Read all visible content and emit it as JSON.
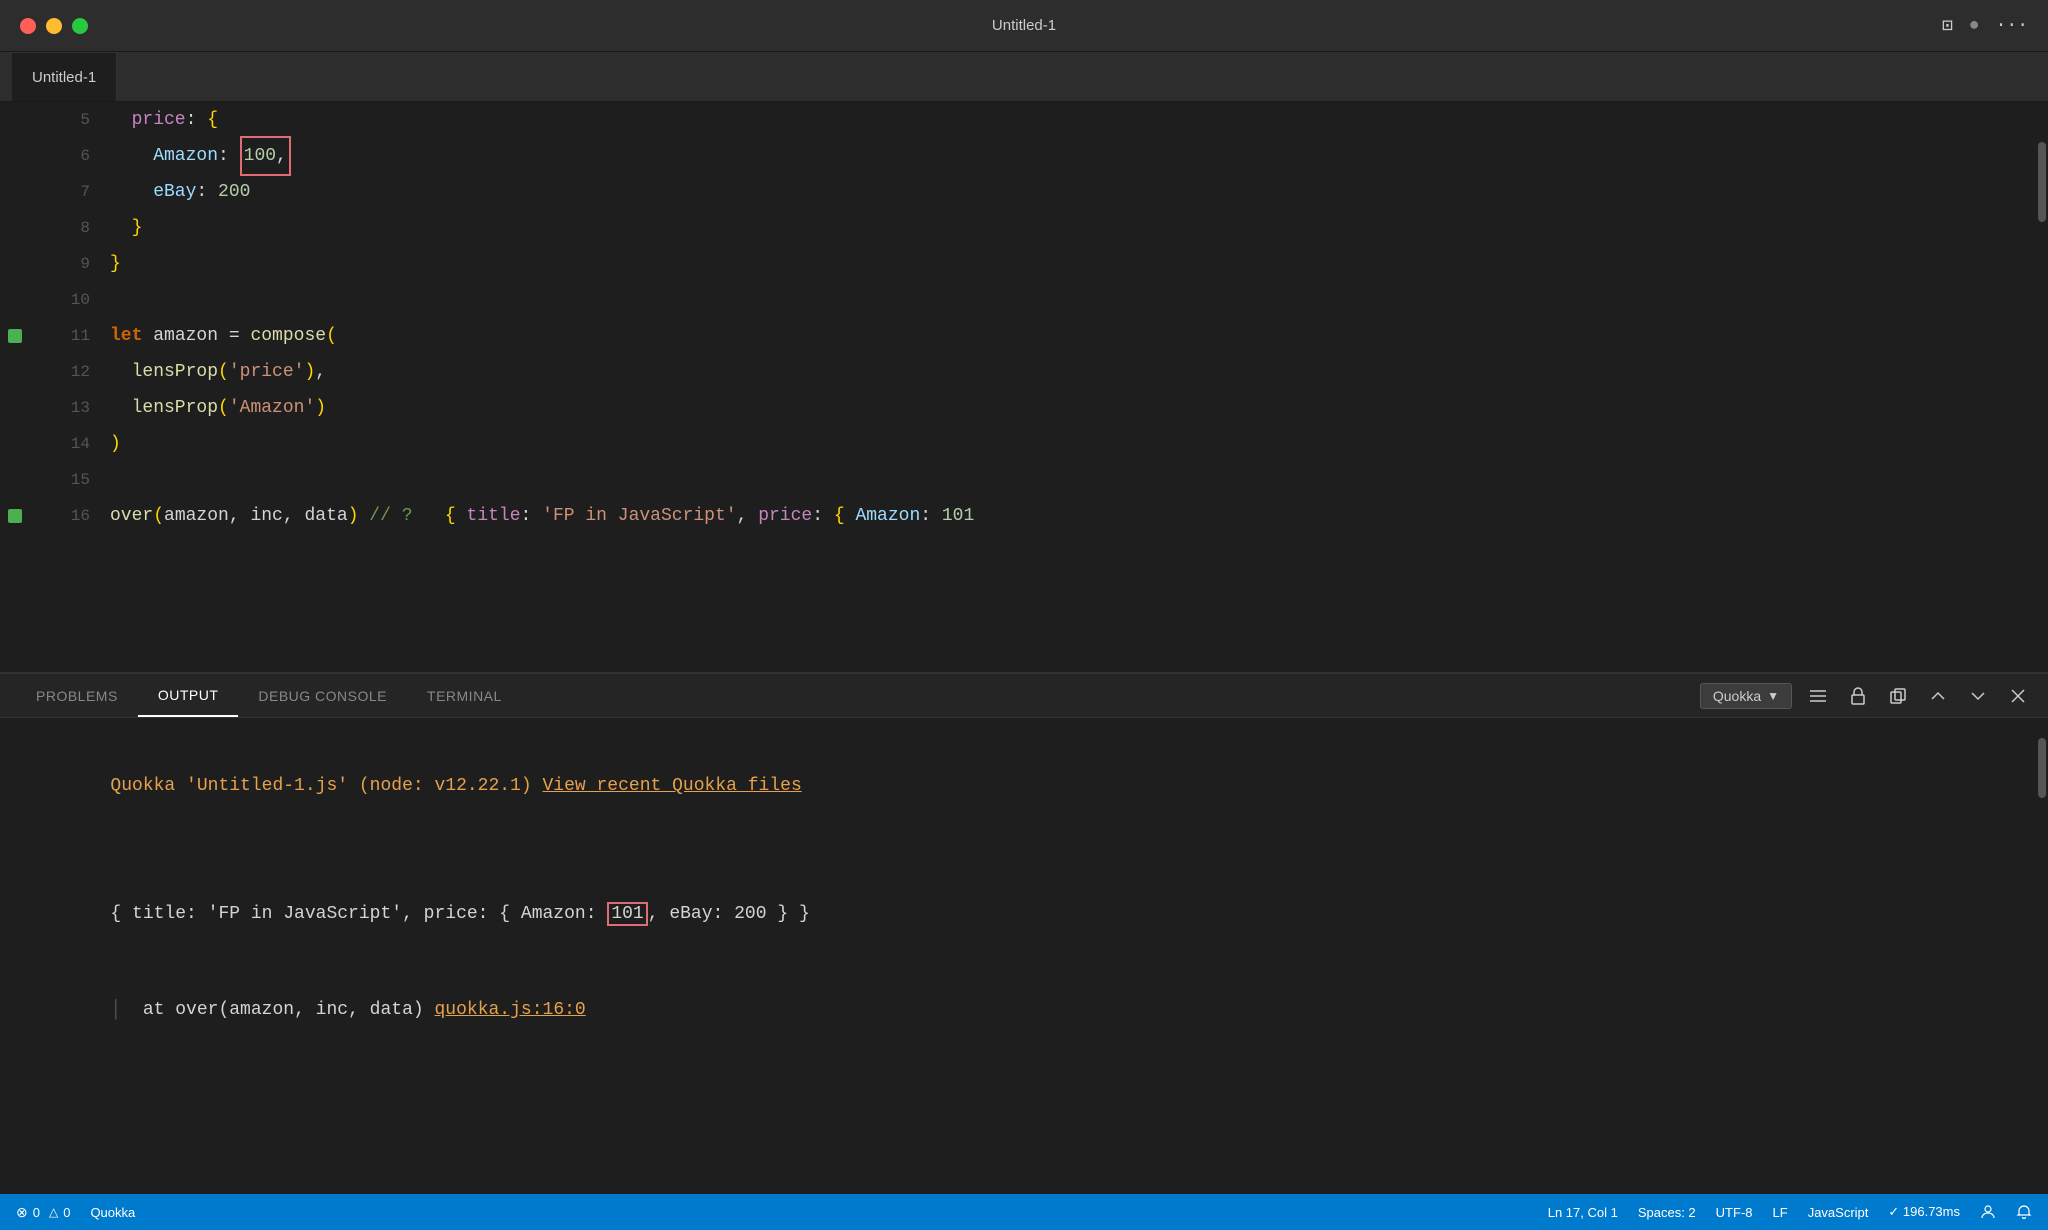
{
  "titlebar": {
    "title": "Untitled-1",
    "buttons": {
      "close": "●",
      "minimize": "●",
      "maximize": "●"
    }
  },
  "tab": {
    "label": "Untitled-1"
  },
  "editor": {
    "lines": [
      {
        "num": 5,
        "gutter": "",
        "content": "price_line"
      },
      {
        "num": 6,
        "gutter": "",
        "content": "amazon_line"
      },
      {
        "num": 7,
        "gutter": "",
        "content": "ebay_line"
      },
      {
        "num": 8,
        "gutter": "",
        "content": "close_price"
      },
      {
        "num": 9,
        "gutter": "",
        "content": "close_obj"
      },
      {
        "num": 10,
        "gutter": "",
        "content": "empty"
      },
      {
        "num": 11,
        "gutter": "green",
        "content": "let_line"
      },
      {
        "num": 12,
        "gutter": "",
        "content": "lensprop_price"
      },
      {
        "num": 13,
        "gutter": "",
        "content": "lensprop_amazon"
      },
      {
        "num": 14,
        "gutter": "",
        "content": "close_paren"
      },
      {
        "num": 15,
        "gutter": "",
        "content": "empty"
      },
      {
        "num": 16,
        "gutter": "green",
        "content": "over_line"
      }
    ]
  },
  "panel": {
    "tabs": [
      "PROBLEMS",
      "OUTPUT",
      "DEBUG CONSOLE",
      "TERMINAL"
    ],
    "active_tab": "OUTPUT",
    "selector": {
      "value": "Quokka",
      "options": [
        "Quokka"
      ]
    },
    "output": {
      "line1": "Quokka 'Untitled-1.js' (node: v12.22.1) ",
      "link": "View recent Quokka files",
      "result_prefix": "{ title: 'FP in JavaScript', price: { Amazon: ",
      "result_highlight": "101",
      "result_suffix": ", eBay: 200 } }",
      "call_line": "  at over(amazon, inc, data) ",
      "call_link": "quokka.js:16:0"
    }
  },
  "statusbar": {
    "errors": "0",
    "warnings": "0",
    "plugin": "Quokka",
    "ln": "Ln 17, Col 1",
    "spaces": "Spaces: 2",
    "encoding": "UTF-8",
    "eol": "LF",
    "language": "JavaScript",
    "timing": "✓ 196.73ms",
    "icons_right": [
      "person-icon",
      "bell-icon"
    ]
  },
  "code": {
    "line5_content": "  price: {",
    "line6_content": "    Amazon: ",
    "line6_value": "100",
    "line6_comma": ",",
    "line7_content": "    eBay: ",
    "line7_value": "200",
    "line8_content": "  }",
    "line9_content": "}",
    "line11_content": "let amazon = compose(",
    "line12_content": "  lensProp('price'),",
    "line13_content": "  lensProp('Amazon')",
    "line14_content": ")",
    "line16_content": "over(amazon, inc, data) // ?   { title: 'FP in JavaScript', price: { Amazon: 101"
  }
}
